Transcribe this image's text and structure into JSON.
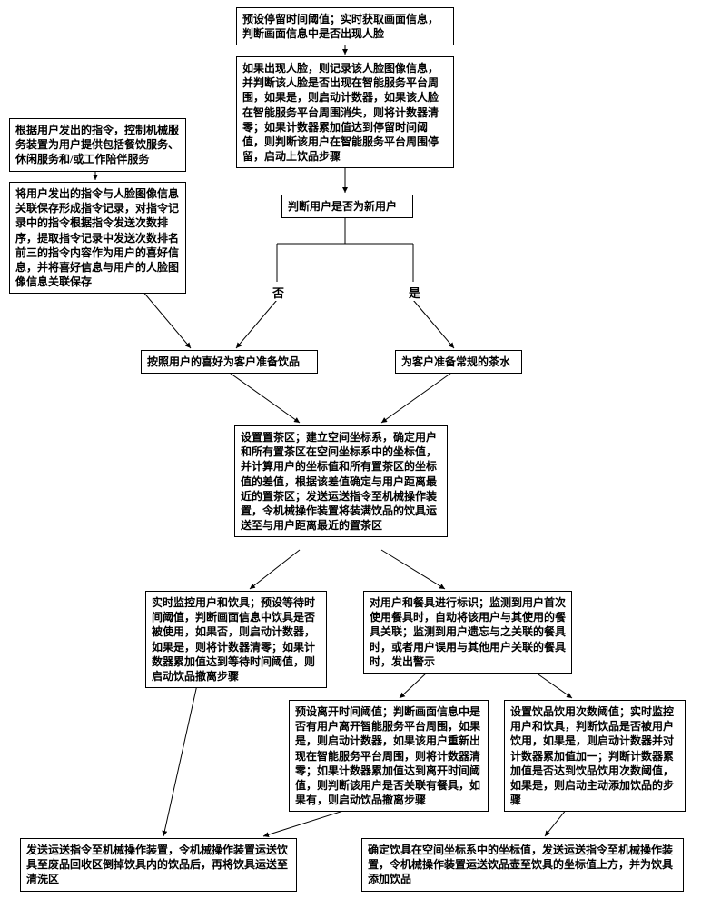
{
  "nodes": {
    "n1": "预设停留时间阈值；实时获取画面信息，判断画面信息中是否出现人脸",
    "n2": "如果出现人脸，则记录该人脸图像信息，并判断该人脸是否出现在智能服务平台周围，如果是，则启动计数器，如果该人脸在智能服务平台周围消失，则将计数器清零；如果计数器累加值达到停留时间阈值，则判断该用户在智能服务平台周围停留，启动上饮品步骤",
    "n3": "根据用户发出的指令，控制机械服务装置为用户提供包括餐饮服务、休闲服务和/或工作陪伴服务",
    "n4": "将用户发出的指令与人脸图像信息关联保存形成指令记录，对指令记录中的指令根据指令发送次数排序，提取指令记录中发送次数排名前三的指令内容作为用户的喜好信息，并将喜好信息与用户的人脸图像信息关联保存",
    "n5": "判断用户是否为新用户",
    "n6": "按照用户的喜好为客户准备饮品",
    "n7": "为客户准备常规的茶水",
    "n8": "设置置茶区；建立空间坐标系，确定用户和所有置茶区在空间坐标系中的坐标值，并计算用户的坐标值和所有置茶区的坐标值的差值，根据该差值确定与用户距离最近的置茶区；发送运送指令至机械操作装置，令机械操作装置将装满饮品的饮具运送至与用户距离最近的置茶区",
    "n9": "实时监控用户和饮具；预设等待时间阈值，判断画面信息中饮具是否被使用，如果否，则启动计数器，如果是，则将计数器清零；如果计数器累加值达到等待时间阈值，则启动饮品撤离步骤",
    "n10": "对用户和餐具进行标识；监测到用户首次使用餐具时，自动将该用户与其使用的餐具关联；监测到用户遗忘与之关联的餐具时，或者用户误用与其他用户关联的餐具时，发出警示",
    "n11": "预设离开时间阈值；判断画面信息中是否有用户离开智能服务平台周围，如果是，则启动计数器，如果该用户重新出现在智能服务平台周围，则将计数器清零；如果计数器累加值达到离开时间阈值，则判断该用户是否关联有餐具，如果有，则启动饮品撤离步骤",
    "n12": "设置饮品饮用次数阈值；实时监控用户和饮具，判断饮品是否被用户饮用，如果是，则启动计数器并对计数器累加值加一；判断计数器累加值是否达到饮品饮用次数阈值，如果是，则启动主动添加饮品的步骤",
    "n13": "发送运送指令至机械操作装置，令机械操作装置运送饮具至废品回收区倒掉饮具内的饮品后，再将饮具运送至清洗区",
    "n14": "确定饮具在空间坐标系中的坐标值，发送运送指令至机械操作装置，令机械操作装置运送饮品壶至饮具的坐标值上方，并为饮具添加饮品"
  },
  "labels": {
    "no": "否",
    "yes": "是"
  }
}
